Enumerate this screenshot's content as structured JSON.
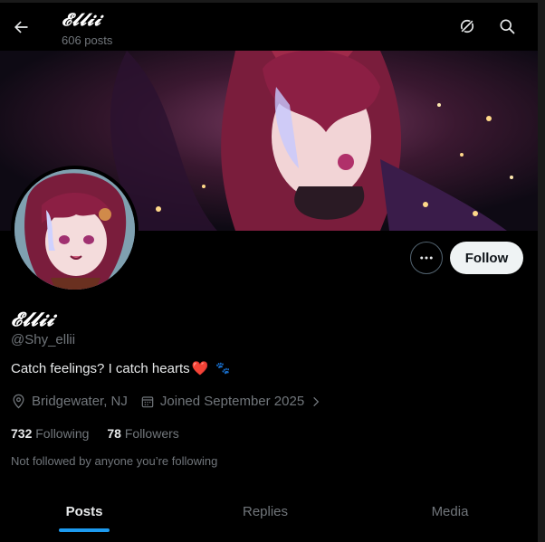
{
  "header": {
    "title": "𝓔𝓵𝓵𝓲𝓲",
    "post_count": "606 posts"
  },
  "profile": {
    "display_name": "𝓔𝓵𝓵𝓲𝓲",
    "handle": "@Shy_ellii",
    "bio": "Catch feelings? I catch hearts",
    "bio_emoji": "❤️",
    "bio_emoji2": "🐾",
    "location": "Bridgewater, NJ",
    "joined": "Joined September 2025",
    "following_count": "732",
    "following_label": "Following",
    "followers_count": "78",
    "followers_label": "Followers",
    "mutual_note": "Not followed by anyone you’re following"
  },
  "actions": {
    "follow_label": "Follow"
  },
  "tabs": [
    {
      "label": "Posts",
      "active": true
    },
    {
      "label": "Replies",
      "active": false
    },
    {
      "label": "Media",
      "active": false
    }
  ],
  "colors": {
    "background": "#000000",
    "accent": "#1d9bf0",
    "follow_bg": "#eff3f4",
    "muted_text": "#71767b"
  }
}
